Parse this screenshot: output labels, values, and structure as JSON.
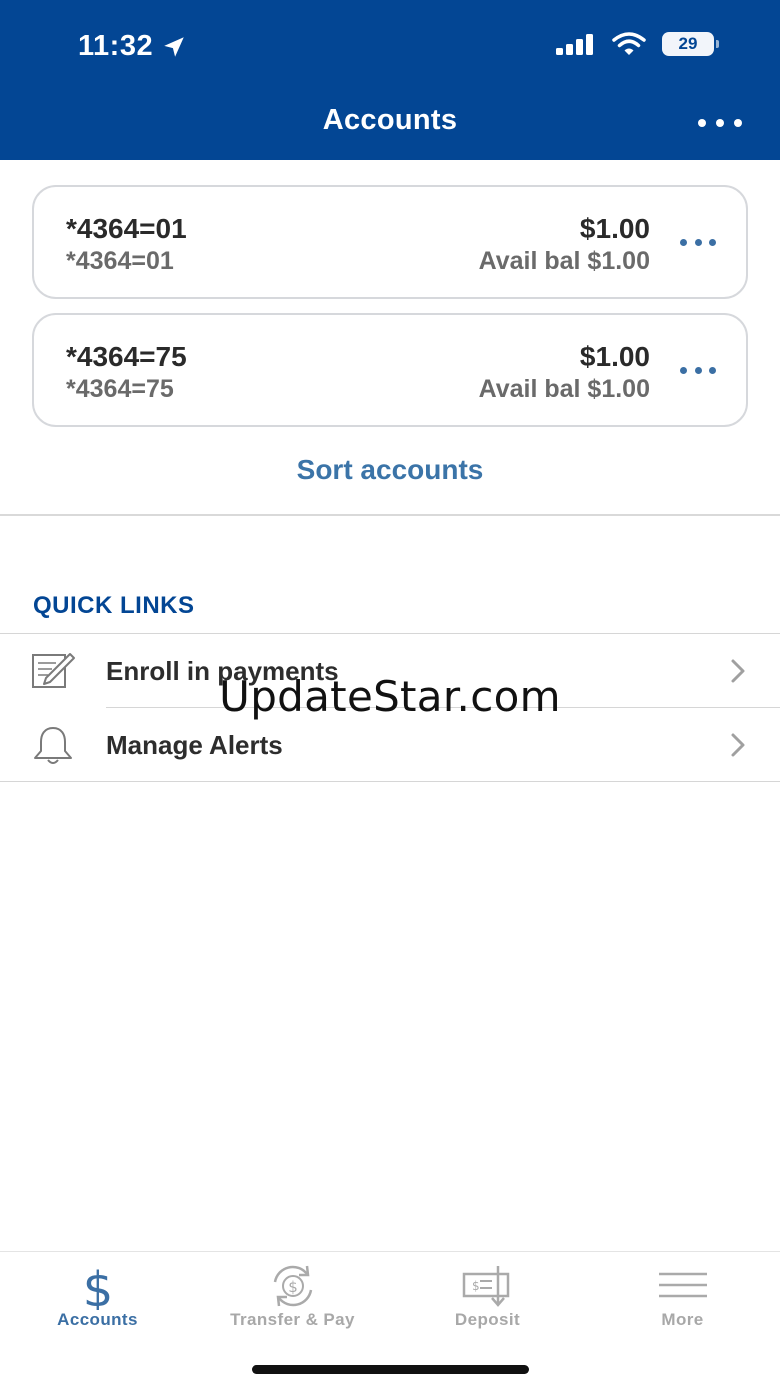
{
  "status": {
    "time": "11:32",
    "battery": "29"
  },
  "header": {
    "title": "Accounts"
  },
  "accounts": [
    {
      "name": "*4364=01",
      "sub": "*4364=01",
      "balance": "$1.00",
      "avail": "Avail bal $1.00"
    },
    {
      "name": "*4364=75",
      "sub": "*4364=75",
      "balance": "$1.00",
      "avail": "Avail bal $1.00"
    }
  ],
  "sort_label": "Sort accounts",
  "quick_links": {
    "heading": "QUICK LINKS",
    "items": [
      {
        "label": "Enroll in payments",
        "icon": "edit-document-icon"
      },
      {
        "label": "Manage Alerts",
        "icon": "bell-icon"
      }
    ]
  },
  "watermark": "UpdateStar.com",
  "tabs": [
    {
      "label": "Accounts",
      "icon": "dollar-icon",
      "active": true
    },
    {
      "label": "Transfer & Pay",
      "icon": "transfer-pay-icon",
      "active": false
    },
    {
      "label": "Deposit",
      "icon": "check-deposit-icon",
      "active": false
    },
    {
      "label": "More",
      "icon": "hamburger-menu-icon",
      "active": false
    }
  ],
  "colors": {
    "brand": "#034694",
    "link": "#3b74a8",
    "tab_inactive": "#a8a8a8"
  }
}
